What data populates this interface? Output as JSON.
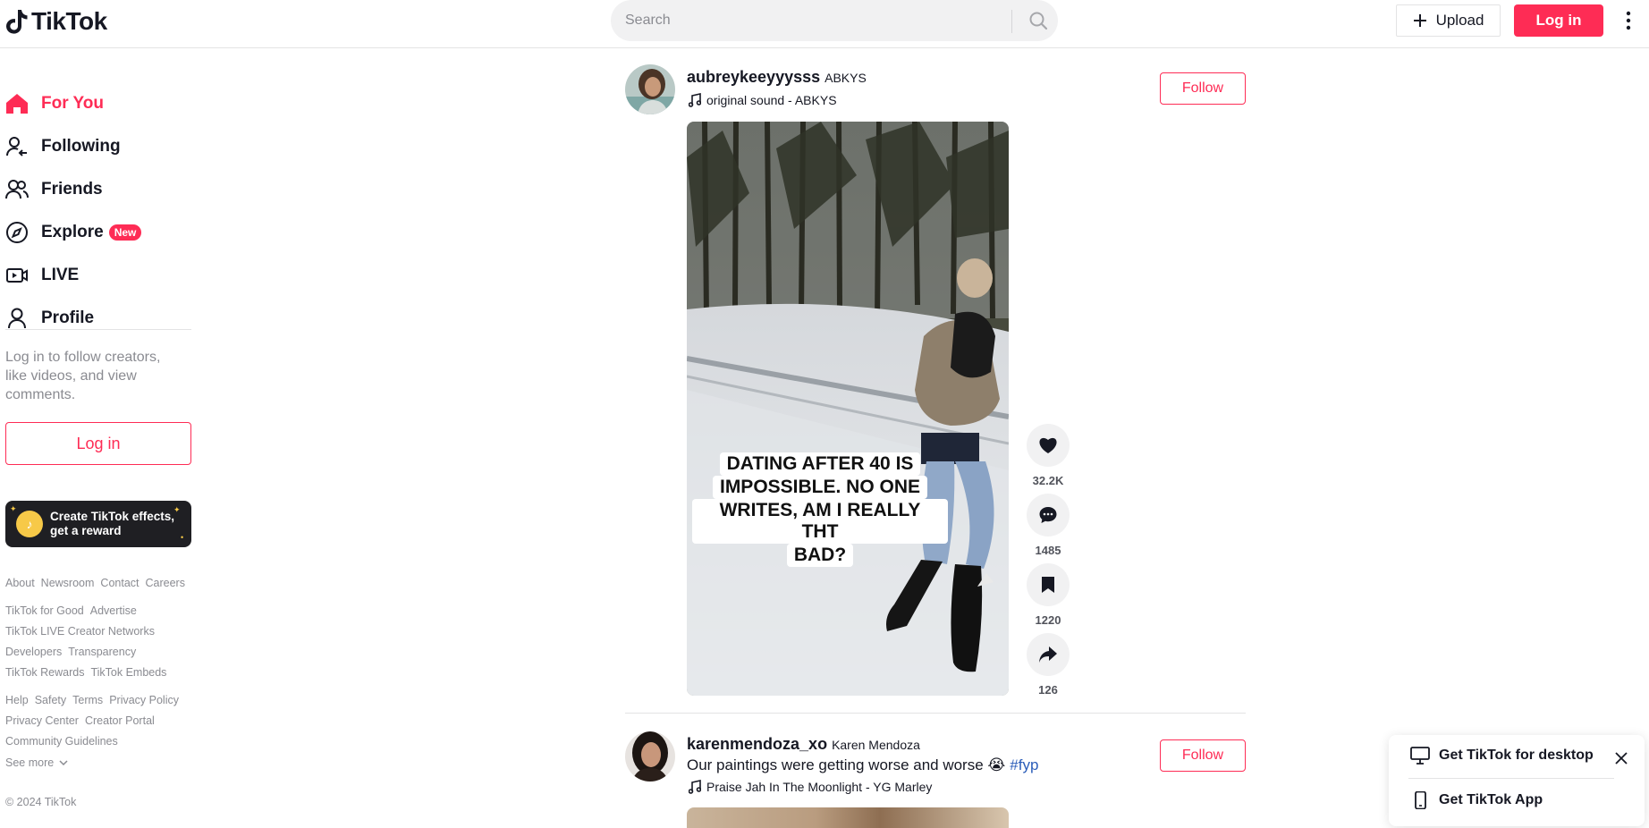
{
  "header": {
    "logo_text": "TikTok",
    "search_placeholder": "Search",
    "upload_label": "Upload",
    "login_label": "Log in"
  },
  "sidebar": {
    "items": [
      {
        "label": "For You",
        "icon": "home-icon",
        "active": true
      },
      {
        "label": "Following",
        "icon": "following-icon"
      },
      {
        "label": "Friends",
        "icon": "friends-icon"
      },
      {
        "label": "Explore",
        "icon": "explore-icon",
        "badge": "New"
      },
      {
        "label": "LIVE",
        "icon": "live-icon"
      },
      {
        "label": "Profile",
        "icon": "profile-icon"
      }
    ],
    "login_prompt": "Log in to follow creators, like videos, and view comments.",
    "login_button": "Log in",
    "effects_banner": "Create TikTok effects, get a reward",
    "footer_rows": [
      [
        "About",
        "Newsroom",
        "Contact",
        "Careers"
      ],
      [
        "TikTok for Good",
        "Advertise"
      ],
      [
        "TikTok LIVE Creator Networks"
      ],
      [
        "Developers",
        "Transparency"
      ],
      [
        "TikTok Rewards",
        "TikTok Embeds"
      ],
      [
        "Help",
        "Safety",
        "Terms",
        "Privacy Policy"
      ],
      [
        "Privacy Center",
        "Creator Portal"
      ],
      [
        "Community Guidelines"
      ]
    ],
    "see_more": "See more",
    "copyright": "© 2024 TikTok"
  },
  "posts": [
    {
      "username": "aubreykeeyyysss",
      "nickname": "ABKYS",
      "music": "original sound - ABKYS",
      "follow_label": "Follow",
      "video_caption": [
        "DATING AFTER 40 IS",
        "IMPOSSIBLE. NO ONE",
        "WRITES, AM I REALLY THT",
        "BAD?"
      ],
      "likes": "32.2K",
      "comments": "1485",
      "saves": "1220",
      "shares": "126"
    },
    {
      "username": "karenmendoza_xo",
      "nickname": "Karen Mendoza",
      "caption": "Our paintings were getting worse and worse 😭",
      "hashtag": "#fyp",
      "music": "Praise Jah In The Moonlight - YG Marley",
      "follow_label": "Follow"
    }
  ],
  "get_app": {
    "desktop_label": "Get TikTok for desktop",
    "app_label": "Get TikTok App"
  },
  "colors": {
    "brand": "#fe2c55",
    "text": "#161823",
    "muted": "#8a8b91",
    "hashtag": "#2b5db9"
  }
}
